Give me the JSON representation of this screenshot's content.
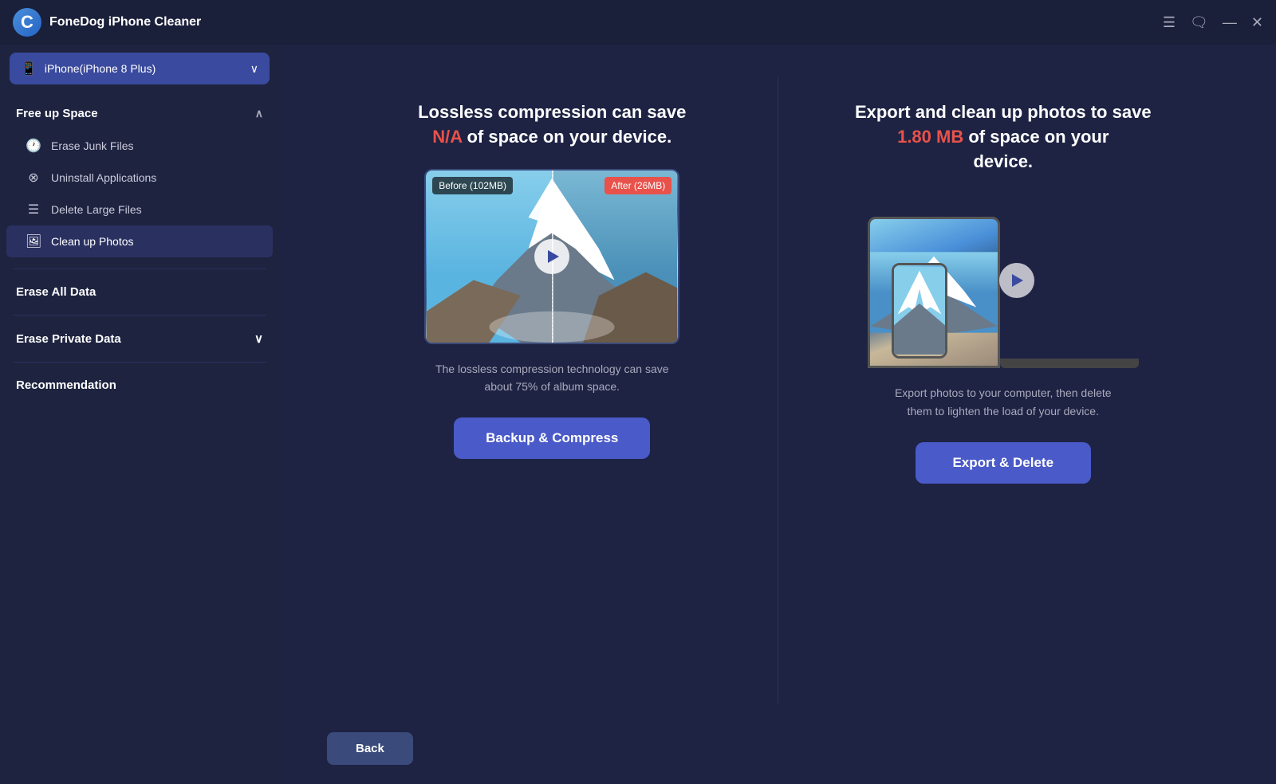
{
  "titleBar": {
    "logo": "C",
    "appTitle": "FoneDog iPhone Cleaner",
    "controls": {
      "menu": "☰",
      "chat": "⬜",
      "minimize": "—",
      "close": "✕"
    }
  },
  "sidebar": {
    "deviceSelector": {
      "deviceName": "iPhone(iPhone 8 Plus)",
      "chevron": "∨"
    },
    "sections": [
      {
        "id": "free-up-space",
        "label": "Free up Space",
        "collapsible": true,
        "collapsed": false,
        "items": [
          {
            "id": "erase-junk",
            "label": "Erase Junk Files",
            "icon": "🕐"
          },
          {
            "id": "uninstall-apps",
            "label": "Uninstall Applications",
            "icon": "⊗"
          },
          {
            "id": "delete-large",
            "label": "Delete Large Files",
            "icon": "☰"
          },
          {
            "id": "clean-photos",
            "label": "Clean up Photos",
            "icon": "🖼"
          }
        ]
      },
      {
        "id": "erase-all-data",
        "label": "Erase All Data",
        "collapsible": false
      },
      {
        "id": "erase-private-data",
        "label": "Erase Private Data",
        "collapsible": true,
        "collapsed": true
      },
      {
        "id": "recommendation",
        "label": "Recommendation",
        "collapsible": false
      }
    ]
  },
  "content": {
    "leftCard": {
      "titlePart1": "Lossless compression can save",
      "titleHighlight": "N/A",
      "titlePart2": "of space on your device.",
      "beforeLabel": "Before (102MB)",
      "afterLabel": "After (26MB)",
      "description": "The lossless compression technology can save about 75% of album space.",
      "buttonLabel": "Backup & Compress"
    },
    "rightCard": {
      "titlePart1": "Export and clean up photos to save",
      "titleHighlight": "1.80 MB",
      "titlePart2": "of space on your device.",
      "description": "Export photos to your computer, then delete them to lighten the load of your device.",
      "buttonLabel": "Export & Delete"
    },
    "backButton": "Back"
  }
}
